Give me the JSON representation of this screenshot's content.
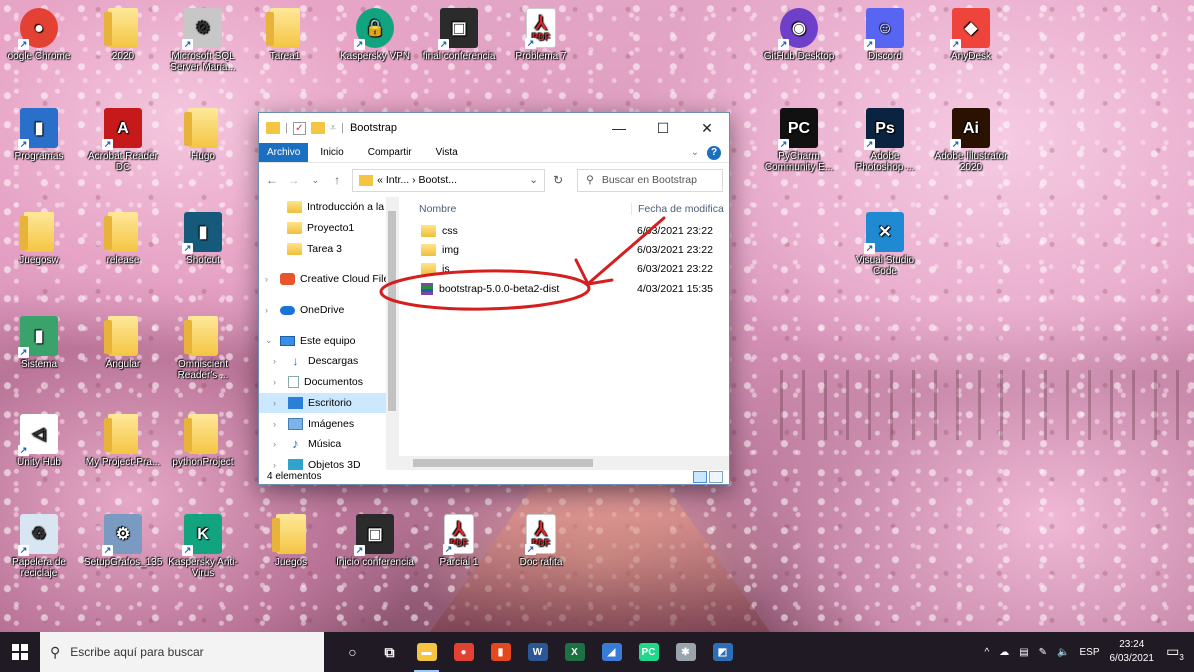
{
  "desktop": {
    "icons": [
      {
        "label": "oogle Chrome",
        "kind": "round",
        "color": "#e34133",
        "glyph": "●"
      },
      {
        "label": "2020",
        "kind": "folder"
      },
      {
        "label": "Microsoft SQL Server Mana...",
        "kind": "tile",
        "color": "#c7c7c7",
        "glyph": "⚙"
      },
      {
        "label": "Tarea1",
        "kind": "folder"
      },
      {
        "label": "Kaspersky VPN",
        "kind": "round",
        "color": "#12a37f",
        "glyph": "🔒"
      },
      {
        "label": "final conferencia",
        "kind": "tile",
        "color": "#2b2b2b",
        "glyph": "▣"
      },
      {
        "label": "Problema 7",
        "kind": "pdf"
      },
      {
        "label": "GitHub Desktop",
        "kind": "round",
        "color": "#6e40c9",
        "glyph": "◉"
      },
      {
        "label": "Discord",
        "kind": "tile",
        "color": "#5865f2",
        "glyph": "☺"
      },
      {
        "label": "AnyDesk",
        "kind": "tile",
        "color": "#ef443b",
        "glyph": "◆"
      },
      {
        "label": "Programas",
        "kind": "tile",
        "color": "#2a6fc9",
        "glyph": "▮"
      },
      {
        "label": "Acrobat Reader DC",
        "kind": "tile",
        "color": "#c61a1a",
        "glyph": "A"
      },
      {
        "label": "Hugo",
        "kind": "folder"
      },
      {
        "label": "PyCharm Community E...",
        "kind": "tile",
        "color": "#111111",
        "glyph": "PC"
      },
      {
        "label": "Adobe Photoshop ...",
        "kind": "tile",
        "color": "#0a2340",
        "glyph": "Ps"
      },
      {
        "label": "Adobe Illustrator 2020",
        "kind": "tile",
        "color": "#2b1200",
        "glyph": "Ai"
      },
      {
        "label": "Juegosw",
        "kind": "folder"
      },
      {
        "label": "release",
        "kind": "folder"
      },
      {
        "label": "Shotcut",
        "kind": "tile",
        "color": "#155a7a",
        "glyph": "▮"
      },
      {
        "label": "Visual Studio Code",
        "kind": "tile",
        "color": "#1f8ad2",
        "glyph": "✕"
      },
      {
        "label": "Sistema",
        "kind": "tile",
        "color": "#3aa36b",
        "glyph": "▮"
      },
      {
        "label": "Angular",
        "kind": "folder"
      },
      {
        "label": "Omniscient Reader's ...",
        "kind": "folder"
      },
      {
        "label": "Unity Hub",
        "kind": "tile",
        "color": "#ffffff",
        "glyph": "◁"
      },
      {
        "label": "My Project-Pra...",
        "kind": "folder"
      },
      {
        "label": "pythonProject",
        "kind": "folder"
      },
      {
        "label": "Papelera de reciclaje",
        "kind": "tile",
        "color": "#d8e6f3",
        "glyph": "♻"
      },
      {
        "label": "SetupGrafos_135",
        "kind": "tile",
        "color": "#7b9ac2",
        "glyph": "⚙"
      },
      {
        "label": "Kaspersky Anti-Virus",
        "kind": "tile",
        "color": "#12a37f",
        "glyph": "K"
      },
      {
        "label": "Juegos",
        "kind": "folder"
      },
      {
        "label": "Inicio conferencia",
        "kind": "tile",
        "color": "#2b2b2b",
        "glyph": "▣"
      },
      {
        "label": "Parcial 1",
        "kind": "pdf"
      },
      {
        "label": "Doc rafita",
        "kind": "pdf"
      }
    ],
    "pdf_label": "PDF"
  },
  "explorer": {
    "title": "Bootstrap",
    "window_buttons": {
      "minimize": "—",
      "maximize": "☐",
      "close": "✕"
    },
    "ribbon_tabs": [
      "Archivo",
      "Inicio",
      "Compartir",
      "Vista"
    ],
    "address": "« Intr... › Bootst...",
    "search_placeholder": "Buscar en Bootstrap",
    "nav_items": [
      {
        "label": "Introducción a la p",
        "icon": "folder",
        "level": 2
      },
      {
        "label": "Proyecto1",
        "icon": "folder",
        "level": 2
      },
      {
        "label": "Tarea 3",
        "icon": "folder",
        "level": 2
      },
      {
        "label": "Creative Cloud Files",
        "icon": "cc",
        "level": 1,
        "chevron": "›"
      },
      {
        "label": "OneDrive",
        "icon": "cloud",
        "level": 1,
        "chevron": "›"
      },
      {
        "label": "Este equipo",
        "icon": "pc",
        "level": 1,
        "chevron": "⌄"
      },
      {
        "label": "Descargas",
        "icon": "down",
        "level": 2,
        "chevron": "›"
      },
      {
        "label": "Documentos",
        "icon": "doc",
        "level": 2,
        "chevron": "›"
      },
      {
        "label": "Escritorio",
        "icon": "desk",
        "level": 2,
        "chevron": "›",
        "selected": true
      },
      {
        "label": "Imágenes",
        "icon": "img",
        "level": 2,
        "chevron": "›"
      },
      {
        "label": "Música",
        "icon": "music",
        "level": 2,
        "chevron": "›"
      },
      {
        "label": "Objetos 3D",
        "icon": "obj",
        "level": 2,
        "chevron": "›"
      }
    ],
    "columns": {
      "name": "Nombre",
      "date": "Fecha de modifica"
    },
    "files": [
      {
        "name": "css",
        "date": "6/03/2021 23:22",
        "icon": "folder"
      },
      {
        "name": "img",
        "date": "6/03/2021 23:22",
        "icon": "folder"
      },
      {
        "name": "js",
        "date": "6/03/2021 23:22",
        "icon": "folder"
      },
      {
        "name": "bootstrap-5.0.0-beta2-dist",
        "date": "4/03/2021 15:35",
        "icon": "zip"
      }
    ],
    "status": "4 elementos"
  },
  "taskbar": {
    "search_placeholder": "Escribe aquí para buscar",
    "apps": [
      {
        "name": "cortana",
        "color": "#1f1a24",
        "glyph": "○"
      },
      {
        "name": "task-view",
        "color": "#1f1a24",
        "glyph": "⧉"
      },
      {
        "name": "file-explorer",
        "color": "#f4c542",
        "glyph": "▬",
        "active": true
      },
      {
        "name": "chrome",
        "color": "#e34133",
        "glyph": "●"
      },
      {
        "name": "office",
        "color": "#e5481f",
        "glyph": "▮"
      },
      {
        "name": "word",
        "color": "#2b5797",
        "glyph": "W"
      },
      {
        "name": "excel",
        "color": "#1e7145",
        "glyph": "X"
      },
      {
        "name": "app-blue",
        "color": "#3a7bd5",
        "glyph": "◢"
      },
      {
        "name": "pycharm",
        "color": "#21d789",
        "glyph": "PC"
      },
      {
        "name": "tool",
        "color": "#9aa4ad",
        "glyph": "✱"
      },
      {
        "name": "photos",
        "color": "#2d6fb5",
        "glyph": "◩"
      }
    ],
    "tray": {
      "chevron": "^",
      "language": "ESP",
      "time": "23:24",
      "date": "6/03/2021",
      "notifications": "3"
    }
  }
}
